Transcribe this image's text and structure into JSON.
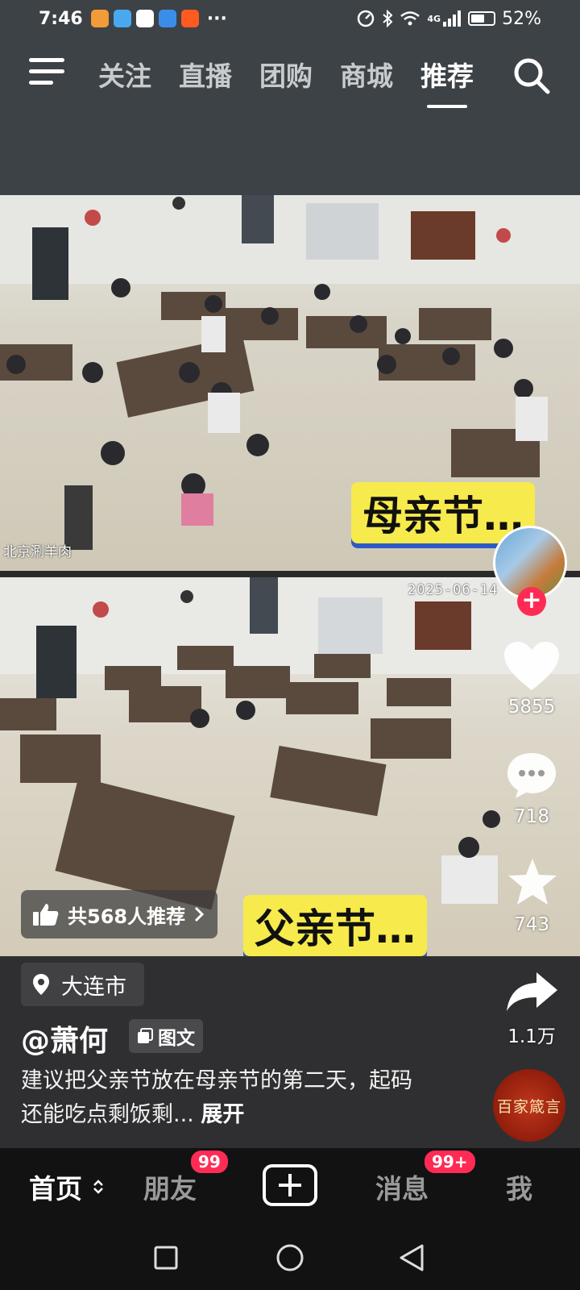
{
  "status_bar": {
    "time": "7:46",
    "more": "···",
    "network": "4G",
    "battery": "52%"
  },
  "top_nav": {
    "tabs": [
      {
        "label": "关注"
      },
      {
        "label": "直播"
      },
      {
        "label": "团购"
      },
      {
        "label": "商城"
      },
      {
        "label": "推荐",
        "active": true
      }
    ]
  },
  "video": {
    "caption_top": "母亲节…",
    "caption_bottom": "父亲节…",
    "timestamp": "2025-06-14",
    "camera_label": "北京涮羊肉"
  },
  "actions": {
    "likes": "5855",
    "comments": "718",
    "favorites": "743",
    "shares": "1.1万"
  },
  "recommend": {
    "label": "共568人推荐"
  },
  "info": {
    "location": "大连市",
    "author": "@萧何",
    "type_badge": "图文",
    "description": "建议把父亲节放在母亲节的第二天，起码还能吃点剩饭剩...",
    "expand": "展开",
    "music_disc_text": "百家箴言"
  },
  "bottom_nav": {
    "home": "首页",
    "friends": "朋友",
    "friends_badge": "99",
    "messages": "消息",
    "messages_badge": "99+",
    "me": "我"
  },
  "colors": {
    "accent": "#fe2c55",
    "caption_bg": "#f7ea4c",
    "caption_shadow": "#2d5bc5"
  }
}
